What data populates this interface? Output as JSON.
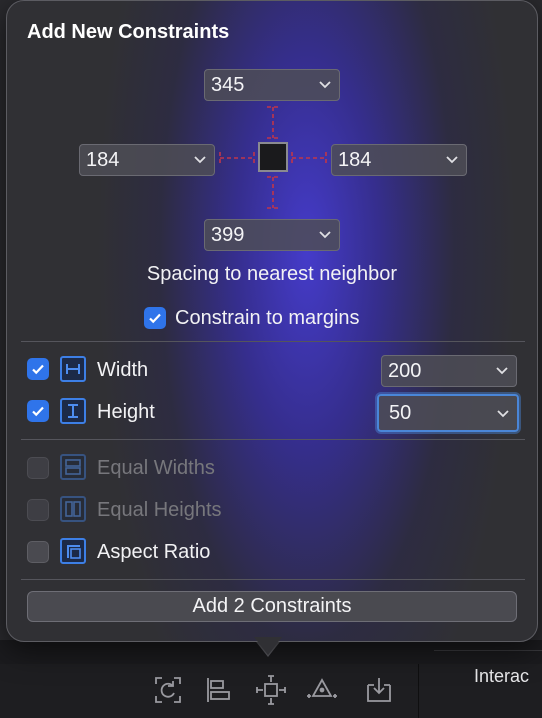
{
  "popover": {
    "title": "Add New Constraints",
    "spacing": {
      "top": "345",
      "left": "184",
      "right": "184",
      "bottom": "399",
      "label": "Spacing to nearest neighbor"
    },
    "constrain_to_margins": {
      "label": "Constrain to margins",
      "checked": true
    },
    "width": {
      "label": "Width",
      "value": "200",
      "checked": true
    },
    "height": {
      "label": "Height",
      "value": "50",
      "checked": true
    },
    "equal_widths": {
      "label": "Equal Widths",
      "checked": false,
      "enabled": false
    },
    "equal_heights": {
      "label": "Equal Heights",
      "checked": false,
      "enabled": false
    },
    "aspect_ratio": {
      "label": "Aspect Ratio",
      "checked": false,
      "enabled": true
    },
    "add_button": "Add 2 Constraints"
  },
  "toolbar": {
    "icons": [
      "update-frames-icon",
      "align-icon",
      "add-constraints-icon",
      "resolve-issues-icon",
      "embed-in-icon"
    ]
  },
  "right_pane": {
    "label": "Interac"
  },
  "colors": {
    "accent": "#2f74ea",
    "constraint_line": "#c0364a"
  }
}
